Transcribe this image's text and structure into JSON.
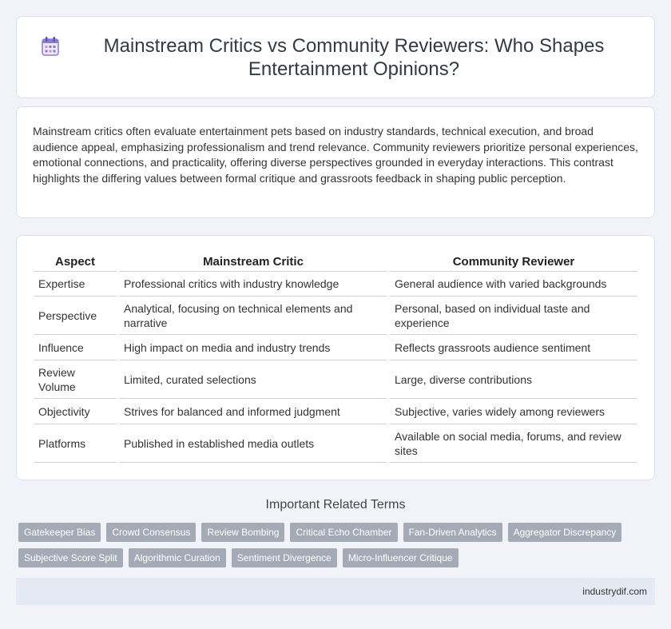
{
  "header": {
    "title": "Mainstream Critics vs Community Reviewers: Who Shapes Entertainment Opinions?",
    "icon": "calendar-icon"
  },
  "intro": "Mainstream critics often evaluate entertainment pets based on industry standards, technical execution, and broad audience appeal, emphasizing professionalism and trend relevance. Community reviewers prioritize personal experiences, emotional connections, and practicality, offering diverse perspectives grounded in everyday interactions. This contrast highlights the differing values between formal critique and grassroots feedback in shaping public perception.",
  "table": {
    "headers": [
      "Aspect",
      "Mainstream Critic",
      "Community Reviewer"
    ],
    "rows": [
      [
        "Expertise",
        "Professional critics with industry knowledge",
        "General audience with varied backgrounds"
      ],
      [
        "Perspective",
        "Analytical, focusing on technical elements and narrative",
        "Personal, based on individual taste and experience"
      ],
      [
        "Influence",
        "High impact on media and industry trends",
        "Reflects grassroots audience sentiment"
      ],
      [
        "Review Volume",
        "Limited, curated selections",
        "Large, diverse contributions"
      ],
      [
        "Objectivity",
        "Strives for balanced and informed judgment",
        "Subjective, varies widely among reviewers"
      ],
      [
        "Platforms",
        "Published in established media outlets",
        "Available on social media, forums, and review sites"
      ]
    ]
  },
  "related": {
    "title": "Important Related Terms",
    "tags": [
      "Gatekeeper Bias",
      "Crowd Consensus",
      "Review Bombing",
      "Critical Echo Chamber",
      "Fan-Driven Analytics",
      "Aggregator Discrepancy",
      "Subjective Score Split",
      "Algorithmic Curation",
      "Sentiment Divergence",
      "Micro-Influencer Critique"
    ]
  },
  "footer": {
    "site": "industrydif.com"
  },
  "colors": {
    "background": "#f1f3f8",
    "tag": "#a5abb6",
    "footer": "#e4e9f3",
    "icon_accent": "#7b68c9"
  }
}
